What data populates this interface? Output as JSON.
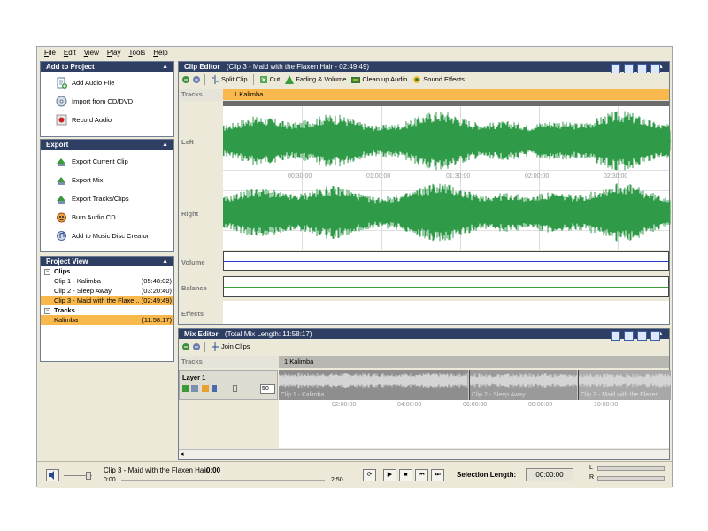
{
  "menu": [
    "File",
    "Edit",
    "View",
    "Play",
    "Tools",
    "Help"
  ],
  "add_panel": {
    "title": "Add to Project",
    "items": [
      "Add Audio File",
      "Import from CD/DVD",
      "Record Audio"
    ]
  },
  "export_panel": {
    "title": "Export",
    "items": [
      "Export Current Clip",
      "Export Mix",
      "Export Tracks/Clips",
      "Burn Audio CD",
      "Add to Music Disc Creator"
    ]
  },
  "project_view": {
    "title": "Project View",
    "clips_label": "Clips",
    "clips": [
      {
        "name": "Clip 1 - Kalimba",
        "duration": "(05:48:02)"
      },
      {
        "name": "Clip 2 - Sleep Away",
        "duration": "(03:20:40)"
      },
      {
        "name": "Clip 3 - Maid with the Flaxe...",
        "duration": "(02:49:49)"
      }
    ],
    "tracks_label": "Tracks",
    "tracks": [
      {
        "name": "Kalimba",
        "duration": "(11:58:17)"
      }
    ]
  },
  "clip_editor": {
    "title": "Clip Editor",
    "subtitle": "(Clip 3 - Maid with the Flaxen Hair - 02:49:49)",
    "toolbar": [
      "Split Clip",
      "Cut",
      "Fading & Volume",
      "Clean up Audio",
      "Sound Effects"
    ],
    "tracks_label": "Tracks",
    "track_name": "1 Kalimba",
    "left_label": "Left",
    "right_label": "Right",
    "volume_label": "Volume",
    "balance_label": "Balance",
    "effects_label": "Effects",
    "time_marks": [
      "00:30:00",
      "01:00:00",
      "01:30:00",
      "02:00:00",
      "02:30:00"
    ]
  },
  "mix_editor": {
    "title": "Mix Editor",
    "subtitle": "(Total Mix Length: 11:58:17)",
    "toolbar": [
      "Join Clips"
    ],
    "tracks_label": "Tracks",
    "track_name": "1 Kalimba",
    "layer_label": "Layer 1",
    "layer_volume": "50",
    "clips": [
      "Clip 1 - Kalimba",
      "Clip 2 - Sleep Away",
      "Clip 3 - Maid with the Flaxen..."
    ],
    "time_marks": [
      "02:00:00",
      "04:00:00",
      "06:00:00",
      "08:00:00",
      "10:00:00"
    ]
  },
  "transport": {
    "now_playing": "Clip 3 - Maid with the Flaxen Hair",
    "now_time": "0:00",
    "pos_start": "0:00",
    "pos_end": "2:50",
    "selection_label": "Selection Length:",
    "selection_value": "00:00:00",
    "meter_l": "L",
    "meter_r": "R"
  },
  "colors": {
    "header": "#2e3f63",
    "accent": "#f8b84c",
    "wave": "#2f9a48"
  }
}
